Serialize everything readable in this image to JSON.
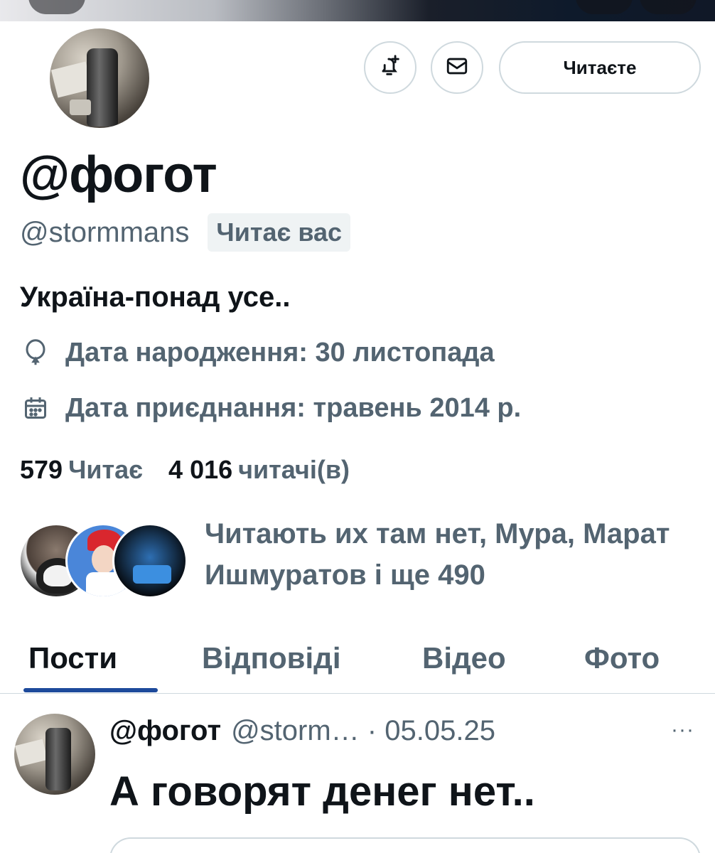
{
  "profile": {
    "display_name": "@фогот",
    "handle": "@stormmans",
    "follows_you_badge": "Читає вас",
    "bio": "Україна-понад усе..",
    "birthday": "Дата народження: 30 листопада",
    "joined": "Дата приєднання: травень 2014 р.",
    "following_count": "579",
    "following_label": "Читає",
    "followers_count": "4 016",
    "followers_label": "читачі(в)",
    "followed_by_text": "Читають их там нет, Мура, Марат Ишмуратов і ще 490"
  },
  "actions": {
    "notify_icon": "bell-plus-icon",
    "message_icon": "envelope-icon",
    "following_button": "Читаєте"
  },
  "tabs": [
    {
      "label": "Пости",
      "active": true
    },
    {
      "label": "Відповіді",
      "active": false
    },
    {
      "label": "Відео",
      "active": false
    },
    {
      "label": "Фото",
      "active": false
    }
  ],
  "post": {
    "author_name": "@фогот",
    "meta": "@storm… · 05.05.25",
    "more": "···",
    "text": "А говорят денег нет.."
  },
  "colors": {
    "text_primary": "#0f1419",
    "text_secondary": "#536471",
    "border": "#cfd9de",
    "tab_indicator": "#1d4a9b"
  }
}
